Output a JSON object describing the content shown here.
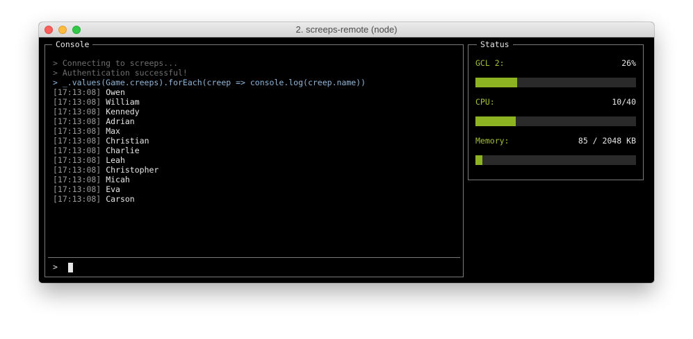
{
  "window": {
    "title": "2. screeps-remote (node)"
  },
  "console": {
    "label": "Console",
    "system_lines": [
      "> Connecting to screeps...",
      "> Authentication successful!"
    ],
    "command_line": "> _.values(Game.creeps).forEach(creep => console.log(creep.name))",
    "output": [
      {
        "time": "[17:13:08]",
        "name": "Owen"
      },
      {
        "time": "[17:13:08]",
        "name": "William"
      },
      {
        "time": "[17:13:08]",
        "name": "Kennedy"
      },
      {
        "time": "[17:13:08]",
        "name": "Adrian"
      },
      {
        "time": "[17:13:08]",
        "name": "Max"
      },
      {
        "time": "[17:13:08]",
        "name": "Christian"
      },
      {
        "time": "[17:13:08]",
        "name": "Charlie"
      },
      {
        "time": "[17:13:08]",
        "name": "Leah"
      },
      {
        "time": "[17:13:08]",
        "name": "Christopher"
      },
      {
        "time": "[17:13:08]",
        "name": "Micah"
      },
      {
        "time": "[17:13:08]",
        "name": "Eva"
      },
      {
        "time": "[17:13:08]",
        "name": "Carson"
      }
    ],
    "prompt": ">",
    "input_value": ""
  },
  "status": {
    "label": "Status",
    "stats": [
      {
        "label": "GCL 2:",
        "value": "26%",
        "fraction": 0.26
      },
      {
        "label": "CPU:",
        "value": "10/40",
        "fraction": 0.25
      },
      {
        "label": "Memory:",
        "value": "85 / 2048 KB",
        "fraction": 0.0415
      }
    ]
  },
  "colors": {
    "accent_label": "#a3c035",
    "bar_fill": "#8db322",
    "bar_track": "#2a2a2a",
    "command_text": "#8fb6d8",
    "system_text": "#6e6e6e"
  }
}
